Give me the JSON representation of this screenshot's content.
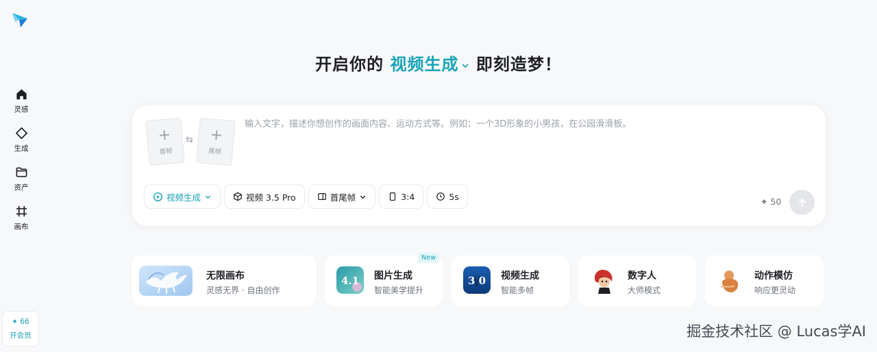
{
  "sidebar": {
    "items": [
      {
        "label": "灵感",
        "icon": "home-icon"
      },
      {
        "label": "生成",
        "icon": "sparkle-diamond-icon"
      },
      {
        "label": "资产",
        "icon": "folder-icon"
      },
      {
        "label": "画布",
        "icon": "canvas-grid-icon"
      }
    ],
    "member": {
      "points": "✦ 66",
      "label": "开会员"
    }
  },
  "heading": {
    "prefix": "开启你的 ",
    "mode": "视频生成",
    "suffix": " 即刻造梦！"
  },
  "prompt": {
    "placeholder": "输入文字，描述你想创作的画面内容、运动方式等。例如：一个3D形象的小男孩，在公园滑滑板。",
    "first_frame": "首帧",
    "last_frame": "尾帧"
  },
  "toolbar": {
    "mode": "视频生成",
    "model": "视频 3.5 Pro",
    "frame_mode": "首尾帧",
    "ratio": "3:4",
    "duration": "5s",
    "credits": "✦ 50"
  },
  "features": [
    {
      "title": "无限画布",
      "subtitle": "灵感无界 · 自由创作"
    },
    {
      "title": "图片生成",
      "subtitle": "智能美学提升",
      "badge": "New",
      "thumb_text": "4.1"
    },
    {
      "title": "视频生成",
      "subtitle": "智能多帧",
      "thumb_text": "3.0"
    },
    {
      "title": "数字人",
      "subtitle": "大师模式"
    },
    {
      "title": "动作模仿",
      "subtitle": "响应更灵动"
    }
  ],
  "watermark": "掘金技术社区 @ Lucas学AI",
  "colors": {
    "accent": "#17a3b6",
    "background": "#f7f8fa"
  }
}
